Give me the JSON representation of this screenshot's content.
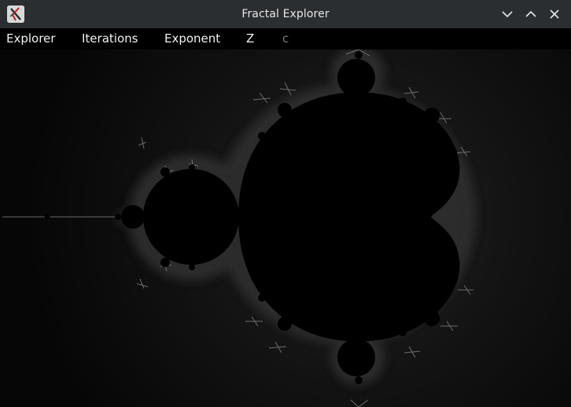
{
  "window": {
    "title": "Fractal Explorer",
    "app_icon": "fractal-app-icon",
    "controls": [
      "minimize-icon",
      "maximize-icon",
      "close-icon"
    ]
  },
  "menubar": {
    "items": [
      {
        "label": "Explorer",
        "enabled": true
      },
      {
        "label": "Iterations",
        "enabled": true
      },
      {
        "label": "Exponent",
        "enabled": true
      },
      {
        "label": "Z",
        "enabled": true
      },
      {
        "label": "c",
        "enabled": false
      }
    ]
  },
  "canvas": {
    "content": "Mandelbrot set",
    "colors": {
      "set": "#000000",
      "background": "#070707",
      "glow": "#2a2a2a",
      "filaments": "#8a8a8a"
    }
  }
}
